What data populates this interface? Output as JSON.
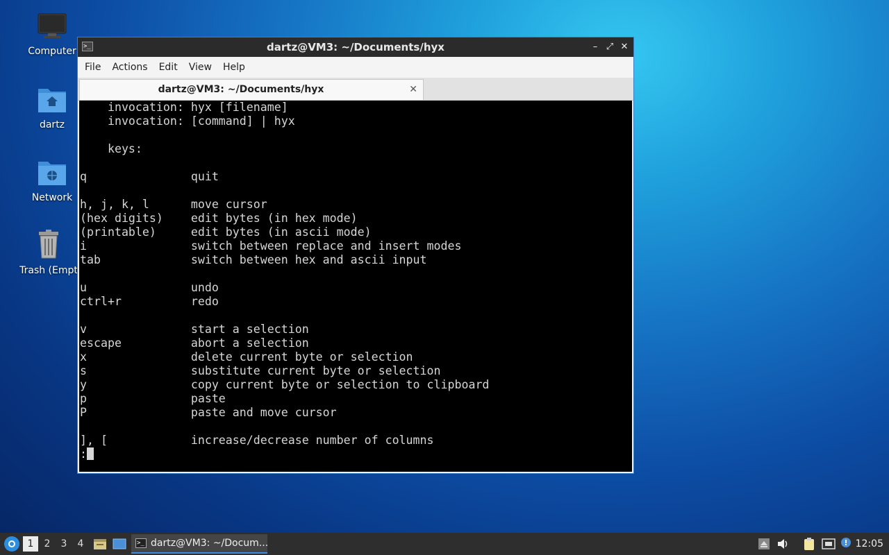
{
  "desktop": {
    "icons": [
      {
        "label": "Computer"
      },
      {
        "label": "dartz"
      },
      {
        "label": "Network"
      },
      {
        "label": "Trash (Empt"
      }
    ]
  },
  "window": {
    "title": "dartz@VM3: ~/Documents/hyx",
    "controls": {
      "minimize": "–",
      "maximize": "⤢",
      "close": "✕"
    },
    "menu": [
      "File",
      "Actions",
      "Edit",
      "View",
      "Help"
    ],
    "tab": {
      "title": "dartz@VM3: ~/Documents/hyx",
      "close": "✕"
    },
    "terminal": {
      "lines": [
        "    invocation: hyx [filename]",
        "    invocation: [command] | hyx",
        "",
        "    keys:",
        "",
        "q               quit",
        "",
        "h, j, k, l      move cursor",
        "(hex digits)    edit bytes (in hex mode)",
        "(printable)     edit bytes (in ascii mode)",
        "i               switch between replace and insert modes",
        "tab             switch between hex and ascii input",
        "",
        "u               undo",
        "ctrl+r          redo",
        "",
        "v               start a selection",
        "escape          abort a selection",
        "x               delete current byte or selection",
        "s               substitute current byte or selection",
        "y               copy current byte or selection to clipboard",
        "p               paste",
        "P               paste and move cursor",
        "",
        "], [            increase/decrease number of columns"
      ],
      "prompt": ":"
    }
  },
  "taskbar": {
    "workspaces": [
      "1",
      "2",
      "3",
      "4"
    ],
    "active_workspace": "1",
    "task_label": "dartz@VM3: ~/Docum...",
    "clock": "12:05"
  },
  "colors": {
    "accent": "#3c8ee6",
    "titlebar": "#2b2b2b",
    "terminal_bg": "#000000",
    "terminal_fg": "#d6d6d6",
    "taskbar": "#2e2e2e"
  }
}
